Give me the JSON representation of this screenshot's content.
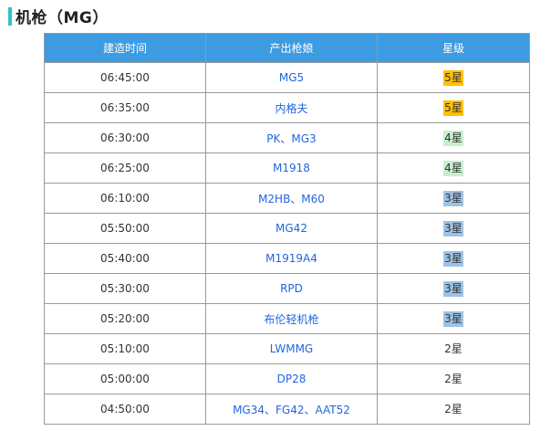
{
  "section": {
    "title": "机枪（MG）",
    "accent_color": "#2ec4c4"
  },
  "table": {
    "header_color": "#3d9be2",
    "headers": {
      "build_time": "建造时间",
      "tdoll": "产出枪娘",
      "rarity": "星级"
    },
    "rows": [
      {
        "time": "06:45:00",
        "tdoll": "MG5",
        "rarity": "5星",
        "rarity_color": "#ffc000"
      },
      {
        "time": "06:35:00",
        "tdoll": "内格夫",
        "rarity": "5星",
        "rarity_color": "#ffc000"
      },
      {
        "time": "06:30:00",
        "tdoll": "PK、MG3",
        "rarity": "4星",
        "rarity_color": "#c6efce"
      },
      {
        "time": "06:25:00",
        "tdoll": "M1918",
        "rarity": "4星",
        "rarity_color": "#c6efce"
      },
      {
        "time": "06:10:00",
        "tdoll": "M2HB、M60",
        "rarity": "3星",
        "rarity_color": "#9dc3e6"
      },
      {
        "time": "05:50:00",
        "tdoll": "MG42",
        "rarity": "3星",
        "rarity_color": "#9dc3e6"
      },
      {
        "time": "05:40:00",
        "tdoll": "M1919A4",
        "rarity": "3星",
        "rarity_color": "#9dc3e6"
      },
      {
        "time": "05:30:00",
        "tdoll": "RPD",
        "rarity": "3星",
        "rarity_color": "#9dc3e6"
      },
      {
        "time": "05:20:00",
        "tdoll": "布伦轻机枪",
        "rarity": "3星",
        "rarity_color": "#9dc3e6"
      },
      {
        "time": "05:10:00",
        "tdoll": "LWMMG",
        "rarity": "2星",
        "rarity_color": ""
      },
      {
        "time": "05:00:00",
        "tdoll": "DP28",
        "rarity": "2星",
        "rarity_color": ""
      },
      {
        "time": "04:50:00",
        "tdoll": "MG34、FG42、AAT52",
        "rarity": "2星",
        "rarity_color": ""
      }
    ]
  }
}
